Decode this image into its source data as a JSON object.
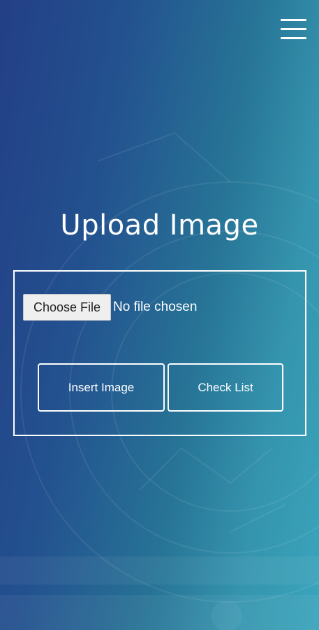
{
  "header": {
    "menu_icon": "hamburger-menu-icon"
  },
  "main": {
    "title": "Upload Image",
    "file_input": {
      "button_label": "Choose File",
      "status_text": "No file chosen"
    },
    "buttons": {
      "insert_label": "Insert Image",
      "check_label": "Check List"
    }
  },
  "colors": {
    "gradient_start": "#233f86",
    "gradient_end": "#3aa5bc",
    "text": "#ffffff"
  }
}
